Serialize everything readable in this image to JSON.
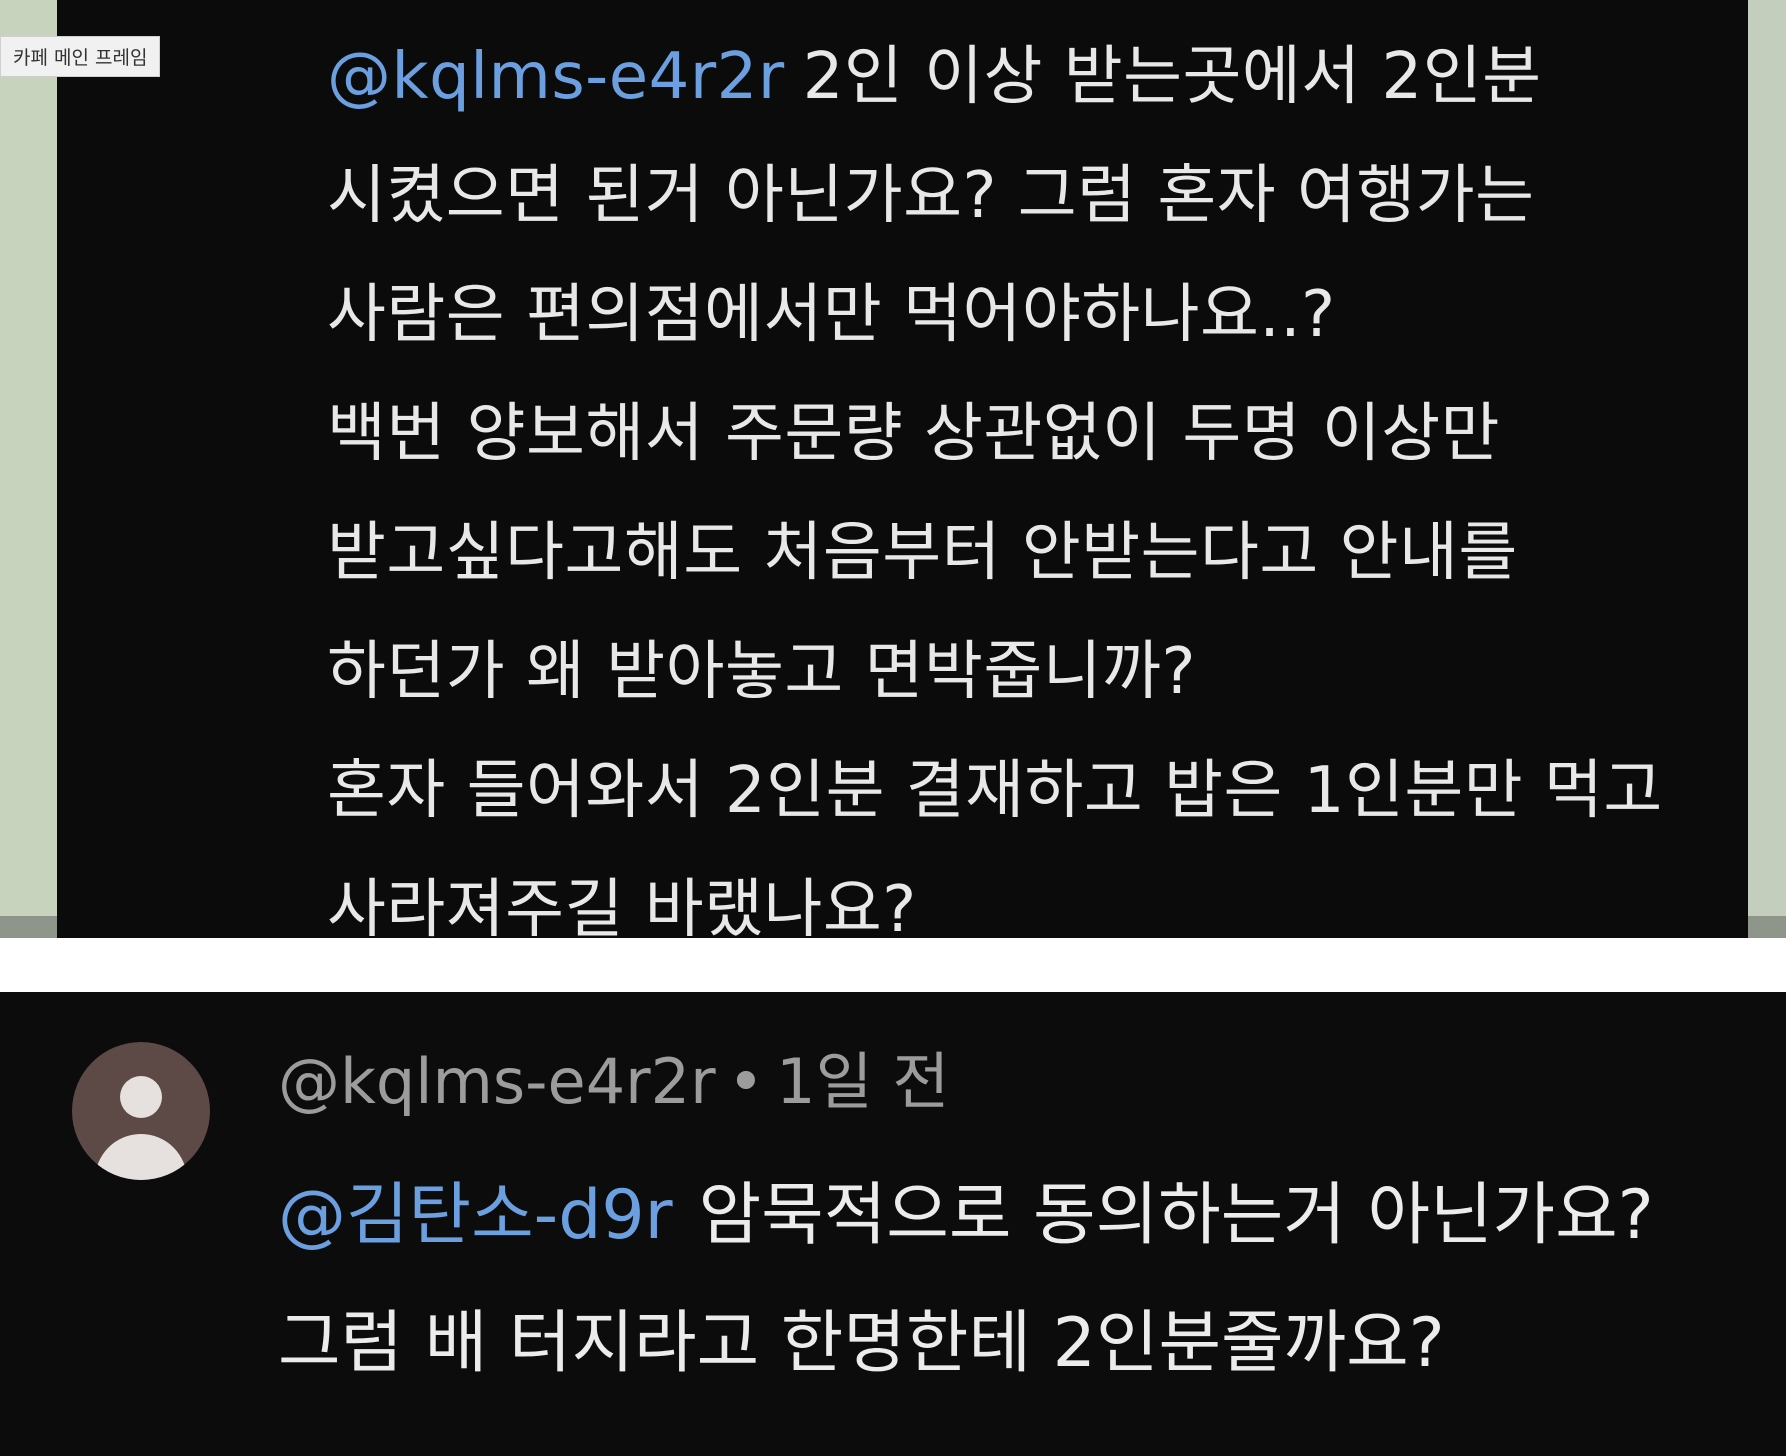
{
  "tooltip": {
    "label": "카페 메인 프레임"
  },
  "top_reply": {
    "mention": "@kqlms-e4r2r",
    "lines": [
      "2인 이상 받는곳에서 2인분",
      "시켰으면 된거 아닌가요? 그럼 혼자 여행가는",
      "사람은 편의점에서만 먹어야하나요..?",
      "백번 양보해서 주문량 상관없이 두명 이상만",
      "받고싶다고해도 처음부터 안받는다고 안내를",
      "하던가 왜 받아놓고 면박줍니까?",
      "혼자 들어와서 2인분 결재하고 밥은 1인분만 먹고",
      "사라져주길 바랬나요?"
    ]
  },
  "bottom_reply": {
    "author": "@kqlms-e4r2r",
    "separator": "•",
    "time": "1일 전",
    "mention": "@김탄소-d9r",
    "lines": [
      "암묵적으로 동의하는거 아닌가요?",
      "그럼 배 터지라고 한명한테 2인분줄까요?"
    ]
  },
  "colors": {
    "mention": "#6b9fe0",
    "screen_bg": "#0b0b0b",
    "outer_bg": "#c7d3bd"
  }
}
